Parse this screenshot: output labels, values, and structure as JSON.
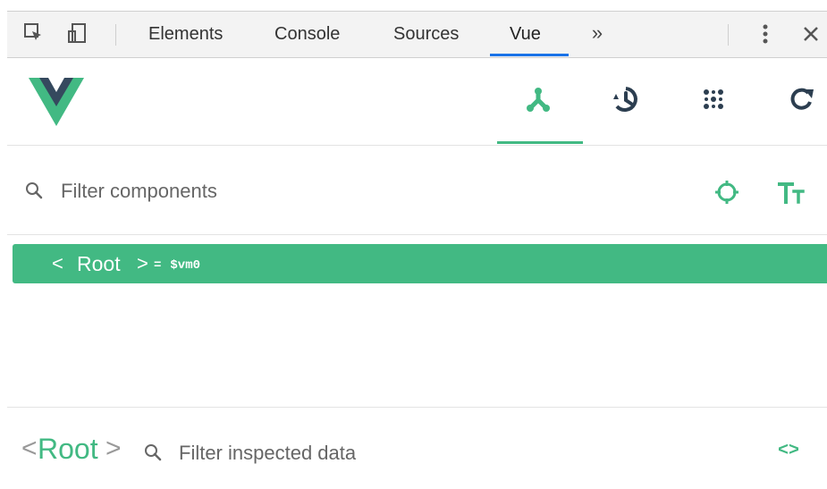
{
  "devtools": {
    "tabs": [
      {
        "label": "Elements"
      },
      {
        "label": "Console"
      },
      {
        "label": "Sources"
      },
      {
        "label": "Vue"
      }
    ],
    "active_tab": "Vue",
    "more_label": "»",
    "icons": [
      "inspect-element-icon",
      "device-toolbar-icon",
      "more-tabs-icon",
      "kebab-menu-icon",
      "close-icon"
    ]
  },
  "vue": {
    "logo": "vue-logo",
    "accent": "#42b983",
    "toolbar": {
      "active": "components",
      "items": [
        "components-icon",
        "history-icon",
        "events-icon",
        "refresh-icon"
      ]
    },
    "components_filter": {
      "placeholder": "Filter components"
    },
    "tree": {
      "root": {
        "name": "Root",
        "open": "<",
        "close": ">",
        "ref_eq": "=",
        "ref": "$vm0"
      }
    },
    "inspector": {
      "open": "<",
      "name": "Root",
      "close": ">",
      "filter_placeholder": "Filter inspected data",
      "code_toggle": "<>"
    }
  }
}
